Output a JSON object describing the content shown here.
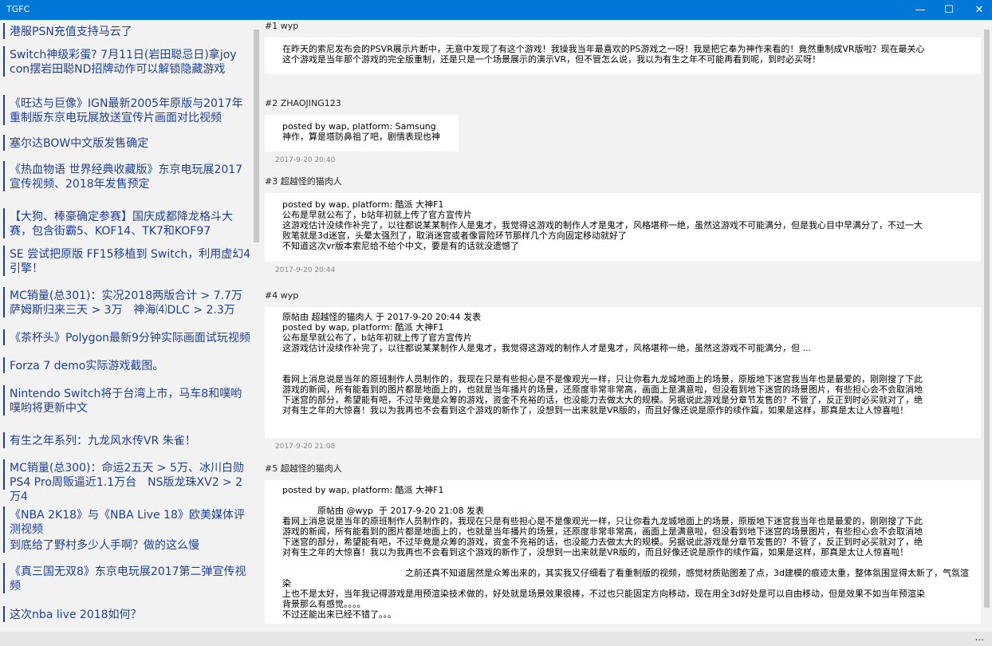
{
  "window": {
    "title": "TGFC",
    "minimize": "—",
    "maximize": "☐",
    "close": "✕"
  },
  "news": [
    "港服PSN充值支持马云了",
    "Switch神级彩蛋? 7月11日(岩田聪忌日)拿joy con摆岩田聪ND招牌动作可以解锁隐藏游戏",
    "《旺达与巨像》IGN最新2005年原版与2017年重制版东京电玩展放送宣传片画面对比视频",
    "塞尔达BOW中文版发售确定",
    "《热血物语 世界经典收藏版》东京电玩展2017宣传视频、2018年发售预定",
    "【大狗、棒豪确定参赛】国庆成都降龙格斗大赛，包含街霸5、KOF14、TK7和KOF97",
    "SE 尝试把原版 FF15移植到 Switch，利用虚幻4引擎！",
    "MC销量(总301)：实况2018两版合计 > 7.7万　萨姆斯归来三天 > 3万　神海⑷DLC > 2.3万",
    "《茶杯头》Polygon最新9分钟实际画面试玩视频",
    "Forza 7 demo实际游戏截图。",
    "Nintendo Switch将于台湾上市，马车8和噗哟噗哟将更新中文",
    "有生之年系列：九龙风水传VR 朱雀！",
    "MC销量(总300)：命运2五天 > 5万、冰川白勋PS4 Pro周贩逼近1.1万台　NS版龙珠XV2 > 2万4",
    "《NBA 2K18》与《NBA Live 18》欧美媒体评测视频",
    "到底给了野村多少人手啊？做的这么慢",
    "《真三国无双8》东京电玩展2017第二弹宣传视频",
    "这次nba live 2018如何？"
  ],
  "posts": [
    {
      "header": "#1 wyp",
      "lines": [
        "在昨天的索尼发布会的PSVR展示片断中，无意中发现了有这个游戏！我操我当年最喜欢的PS游戏之一呀！我是把它奉为神作来看的！竟然重制成VR版啦？现在最关心",
        "这个游戏是当年那个游戏的完全版重制，还是只是一个场景展示的演示VR，但不管怎么说，我以为有生之年不可能再看到呢，到时必买呀！"
      ],
      "time": ""
    },
    {
      "header": "#2 ZHAOJING123",
      "lines": [
        "posted by wap, platform: Samsung",
        "神作，算是塔防鼻祖了吧，剧情表现也神"
      ],
      "time": "2017-9-20 20:40"
    },
    {
      "header": "#3 超越怪的猫肉人",
      "lines": [
        "posted by wap, platform: 酷派 大神F1",
        "公布是早就公布了，b站年初就上传了官方宣传片",
        "这游戏估计没续作补完了，以往都说某某制作人是鬼才，我觉得这游戏的制作人才是鬼才，风格堪称一绝，虽然这游戏不可能满分，但是我心目中早满分了，不过一大",
        "败笔就是3d迷宫，头晕太强烈了，取消迷宫或者像冒险环节那样几个方向固定移动就好了",
        "不知道这次vr版本索尼给不给个中文，要是有的话就没遗憾了"
      ],
      "time": "2017-9-20 20:44"
    },
    {
      "header": "#4 wyp",
      "lines": [
        "原帖由 超越怪的猫肉人 于 2017-9-20 20:44 发表",
        "posted by wap, platform: 酷派 大神F1",
        "公布是早就公布了，b站年初就上传了官方宣传片",
        "这游戏估计没续作补完了，以往都说某某制作人是鬼才，我觉得这游戏的制作人才是鬼才，风格堪称一绝，虽然这游戏不可能满分，但 ...",
        "",
        "",
        "看网上消息说是当年的原班制作人员制作的，我现在只是有些担心是不是像观光一样，只让你看九龙城地面上的场景，原版地下迷宫我当年也是最爱的，刚刚搜了下此",
        "游戏的新闻，所有能看到的图片都是地面上的，也就是当年播片的场景，还原度非常非常高，画面上是满意啦，但没看到地下迷宫的场景图片，有些担心会不会取消地",
        "下迷宫的部分，希望能有吧，不过毕竟是众筹的游戏，资金不充裕的话，也没能力去做太大的规模。另据说此游戏是分章节发售的？不管了，反正到时必买就对了，绝",
        "对有生之年的大惊喜！我以为我再也不会看到这个游戏的新作了，没想到一出来就是VR版的，而且好像还说是原作的续作篇，如果是这样，那真是太让人惊喜啦！"
      ],
      "time": "2017-9-20 21:08"
    },
    {
      "header": "#5 超越怪的猫肉人",
      "lines": [
        "posted by wap, platform: 酷派 大神F1",
        "",
        "　　　　原帖由 @wyp  于 2017-9-20 21:08 发表",
        "看网上消息说是当年的原班制作人员制作的，我现在只是有些担心是不是像观光一样，只让你看九龙城地面上的场景，原版地下迷宫我当年也是最爱的，刚刚搜了下此",
        "游戏的新闻，所有能看到的图片都是地面上的，也就是当年播片的场景，还原度非常非常高，画面上是满意啦，但没看到地下迷宫的场景图片，有些担心会不会取消地",
        "下迷宫的部分，希望能有吧，不过毕竟是众筹的游戏，资金不充裕的话，也没能力去做太大的规模。另据说此游戏是分章节发售的？不管了，反正到时必买就对了，绝",
        "对有生之年的大惊喜！我以为我再也不会看到这个游戏的新作了，没想到一出来就是VR版的，而且好像还说是原作的续作篇，如果是这样，那真是太让人惊喜啦！",
        "",
        "　　　　　　　　　　　　　　之前还真不知道居然是众筹出来的，其实我又仔细看了看重制版的视频，感觉材质贴图差了点，3d建模的痕迹太重，整体氛围显得太新了，气氛渲染",
        "上也不是太好，当年我记得游戏是用预渲染技术做的，好处就是场景效果很棒，不过也只能固定方向移动，现在用全3d好处是可以自由移动，但是效果不如当年预渲染",
        "背景那么有感觉。。。。",
        "不过还能出来已经不错了。。。"
      ],
      "time": ""
    }
  ],
  "status": {
    "more": "..."
  }
}
